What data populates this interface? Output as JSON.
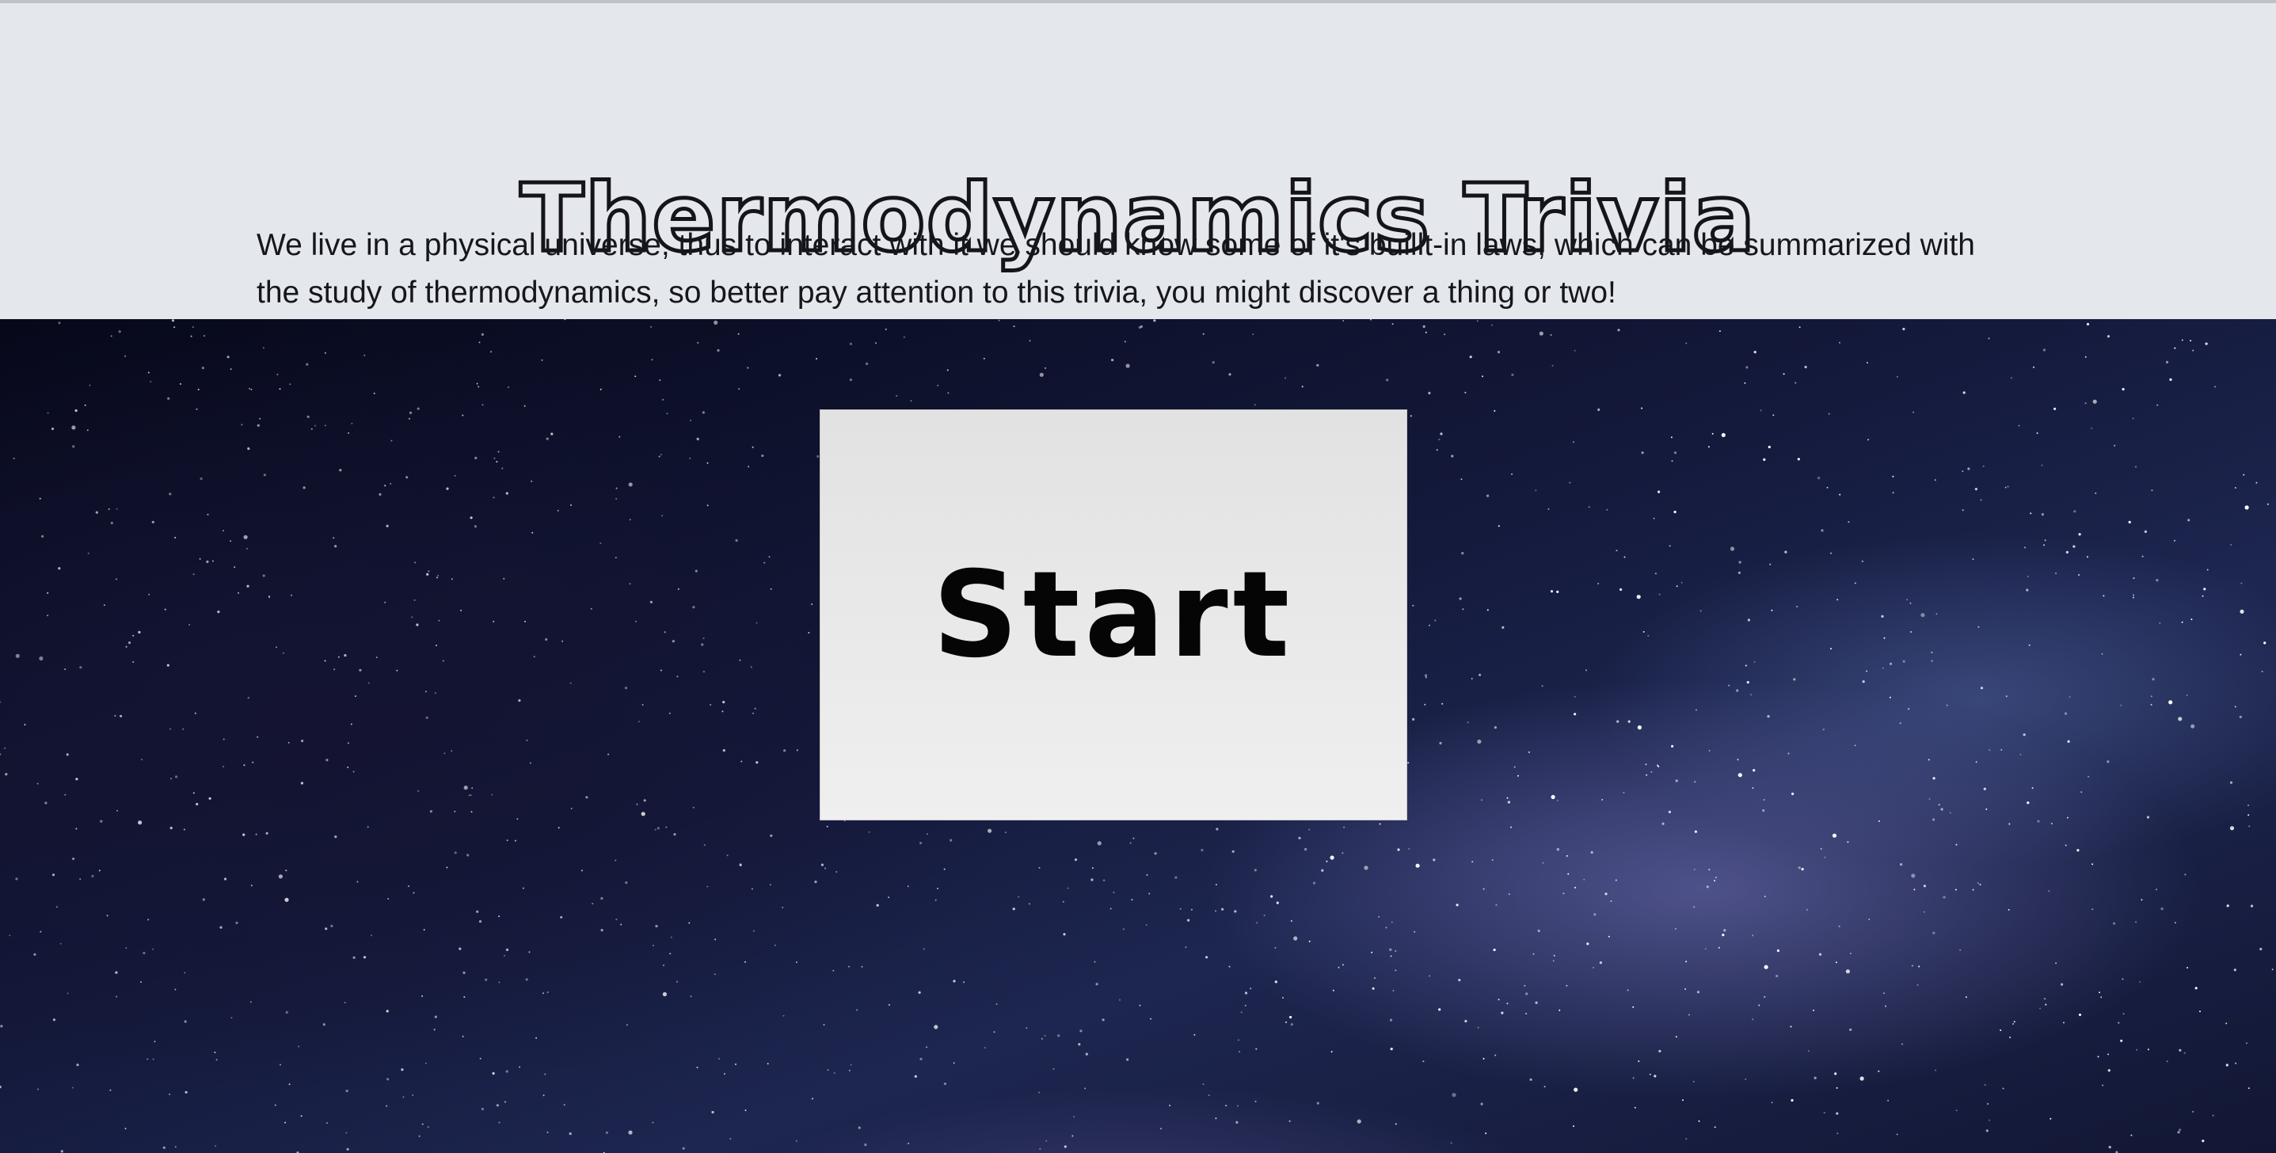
{
  "header": {
    "title": "Thermodynamics Trivia",
    "intro": "We live in a physical universe, thus to interact with it we should know some of it's buillt-in laws, which can be summarized with the study of thermodynamics, so better pay attention to this trivia, you might discover a thing or two!"
  },
  "main": {
    "start_label": "Start",
    "background": "starfield"
  },
  "colors": {
    "header_bg": "#e4e7ec",
    "card_bg": "#e9e9e9",
    "text": "#16171c"
  }
}
